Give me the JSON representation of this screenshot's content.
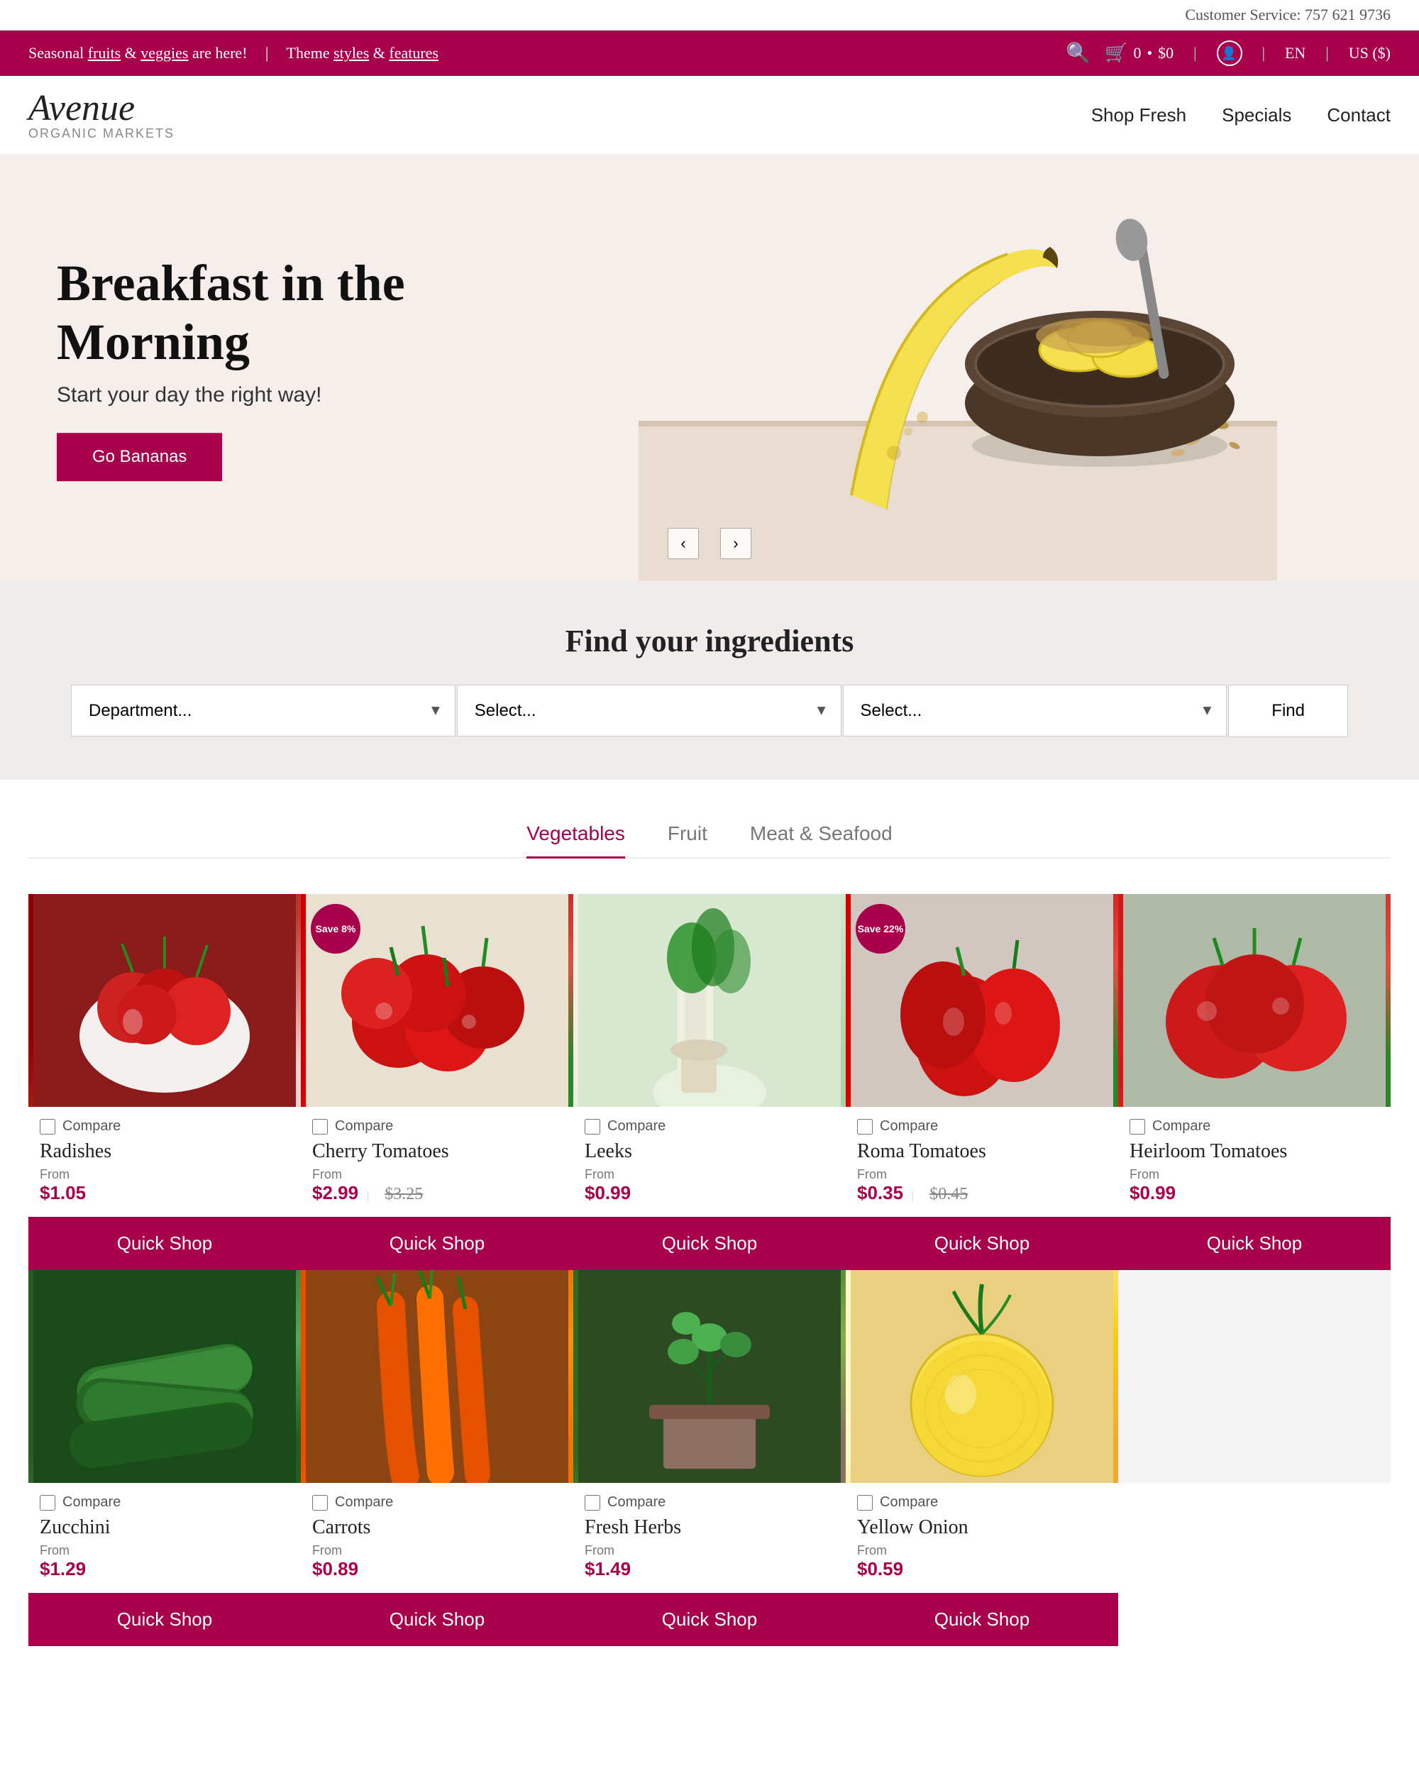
{
  "customer_service": {
    "label": "Customer Service: 757 621 9736"
  },
  "announcement": {
    "text_before": "Seasonal ",
    "link1": "fruits",
    "text_mid1": " & ",
    "link2": "veggies",
    "text_after": " are here!",
    "divider": "|",
    "theme_text": "Theme ",
    "styles_link": "styles",
    "and": " & ",
    "features_link": "features"
  },
  "cart": {
    "count": "0",
    "total": "$0"
  },
  "lang": "EN",
  "currency": "US ($)",
  "logo": {
    "name": "Avenue",
    "sub": "organic markets"
  },
  "nav": {
    "items": [
      {
        "label": "Shop Fresh",
        "href": "#"
      },
      {
        "label": "Specials",
        "href": "#"
      },
      {
        "label": "Contact",
        "href": "#"
      }
    ]
  },
  "hero": {
    "heading": "Breakfast in the Morning",
    "subheading": "Start your day the right way!",
    "button_label": "Go Bananas"
  },
  "search_section": {
    "heading": "Find your ingredients",
    "department_placeholder": "Department...",
    "select1_placeholder": "Select...",
    "select2_placeholder": "Select...",
    "find_button": "Find"
  },
  "tabs": [
    {
      "label": "Vegetables",
      "active": true
    },
    {
      "label": "Fruit",
      "active": false
    },
    {
      "label": "Meat & Seafood",
      "active": false
    }
  ],
  "products": [
    {
      "name": "Radishes",
      "price_from": "From",
      "price": "$1.05",
      "old_price": null,
      "save": null,
      "compare": "Compare",
      "quick_shop": "Quick Shop",
      "img_class": "img-radishes"
    },
    {
      "name": "Cherry Tomatoes",
      "price_from": "From",
      "price": "$2.99",
      "old_price": "$3.25",
      "save": "Save 8%",
      "compare": "Compare",
      "quick_shop": "Quick Shop",
      "img_class": "img-cherry-tomatoes"
    },
    {
      "name": "Leeks",
      "price_from": "From",
      "price": "$0.99",
      "old_price": null,
      "save": null,
      "compare": "Compare",
      "quick_shop": "Quick Shop",
      "img_class": "img-leeks"
    },
    {
      "name": "Roma Tomatoes",
      "price_from": "From",
      "price": "$0.35",
      "old_price": "$0.45",
      "save": "Save 22%",
      "compare": "Compare",
      "quick_shop": "Quick Shop",
      "img_class": "img-roma-tomatoes"
    },
    {
      "name": "Heirloom Tomatoes",
      "price_from": "From",
      "price": "$0.99",
      "old_price": null,
      "save": null,
      "compare": "Compare",
      "quick_shop": "Quick Shop",
      "img_class": "img-heirloom-tomatoes"
    },
    {
      "name": "Zucchini",
      "price_from": "From",
      "price": "$1.29",
      "old_price": null,
      "save": null,
      "compare": "Compare",
      "quick_shop": "Quick Shop",
      "img_class": "img-zucchini"
    },
    {
      "name": "Carrots",
      "price_from": "From",
      "price": "$0.89",
      "old_price": null,
      "save": null,
      "compare": "Compare",
      "quick_shop": "Quick Shop",
      "img_class": "img-carrots"
    },
    {
      "name": "Fresh Herbs",
      "price_from": "From",
      "price": "$1.49",
      "old_price": null,
      "save": null,
      "compare": "Compare",
      "quick_shop": "Quick Shop",
      "img_class": "img-herbs"
    },
    {
      "name": "Yellow Onion",
      "price_from": "From",
      "price": "$0.59",
      "old_price": null,
      "save": null,
      "compare": "Compare",
      "quick_shop": "Quick Shop",
      "img_class": "img-onion"
    },
    {
      "name": "",
      "price_from": "",
      "price": "",
      "old_price": null,
      "save": null,
      "compare": "",
      "quick_shop": "",
      "img_class": "img-white"
    }
  ],
  "accent_color": "#a8004a"
}
